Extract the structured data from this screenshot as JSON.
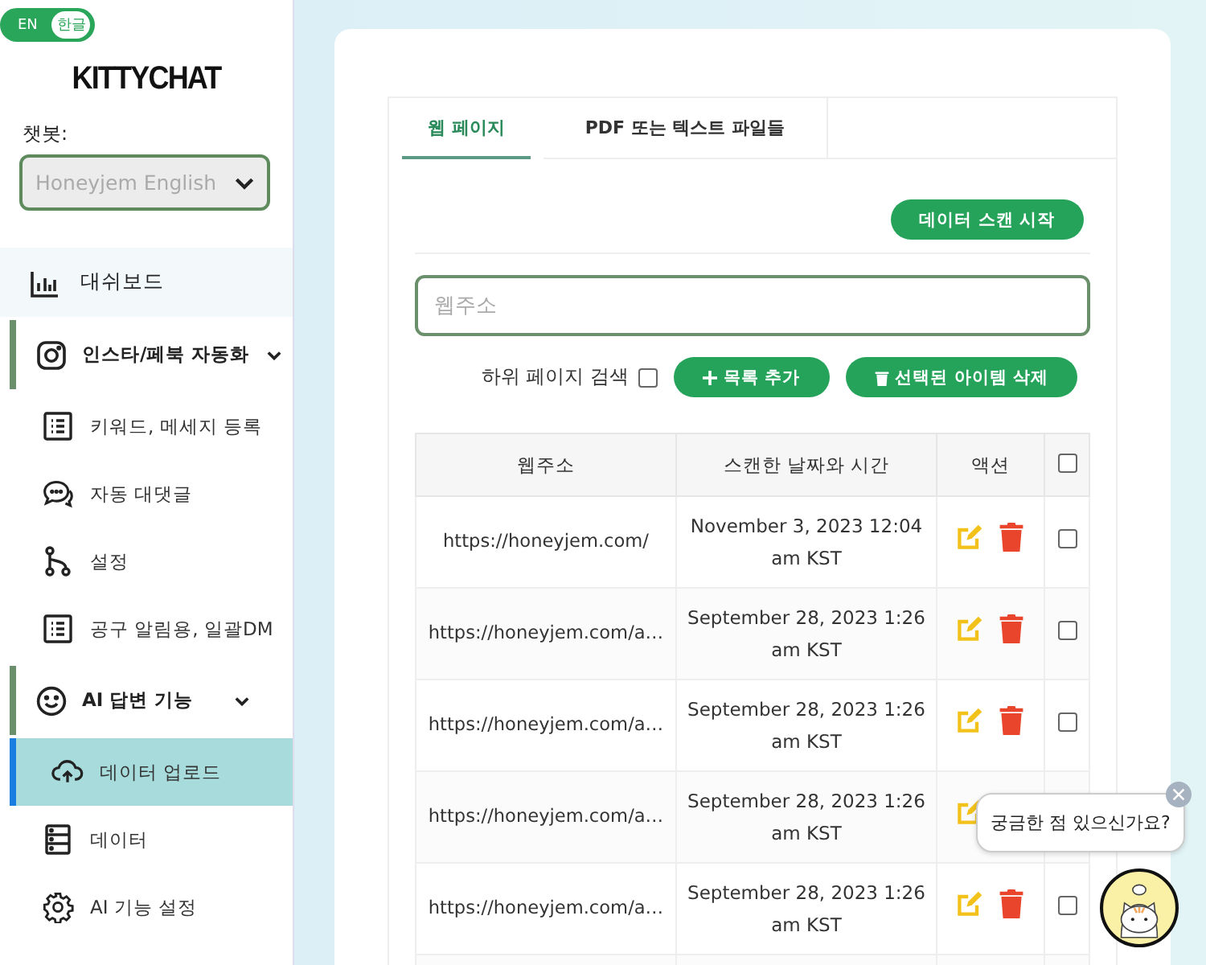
{
  "language_toggle": [
    {
      "label": "EN",
      "selected": false
    },
    {
      "label": "한글",
      "selected": true
    }
  ],
  "logo": "KITTYCHAT",
  "chatbot_select": {
    "label": "챗봇:",
    "value": "Honeyjem English"
  },
  "sidebar": {
    "items": [
      {
        "label": "대쉬보드",
        "kind": "top",
        "selected": false
      },
      {
        "label": "인스타/페북 자동화",
        "kind": "group",
        "expanded": true,
        "children": [
          {
            "label": "키워드, 메세지 등록",
            "selected": false
          },
          {
            "label": "자동 대댓글",
            "selected": false
          },
          {
            "label": "설정",
            "selected": false
          },
          {
            "label": "공구 알림용, 일괄DM",
            "selected": false
          }
        ]
      },
      {
        "label": "AI 답변 기능",
        "kind": "group",
        "expanded": true,
        "children": [
          {
            "label": "데이터 업로드",
            "selected": true
          },
          {
            "label": "데이터",
            "selected": false
          },
          {
            "label": "AI 기능 설정",
            "selected": false
          }
        ]
      }
    ]
  },
  "tabs": [
    {
      "label": "웹 페이지",
      "selected": true
    },
    {
      "label": "PDF 또는 텍스트 파일들",
      "selected": false
    }
  ],
  "scan_button": "데이터 스캔 시작",
  "url_field": {
    "placeholder": "웹주소"
  },
  "subpage_search": {
    "label": "하위 페이지 검색",
    "checked": false
  },
  "add_button": "목록 추가",
  "delete_button": "선택된 아이템 삭제",
  "table": {
    "columns": [
      "웹주소",
      "스캔한 날짜와 시간",
      "액션"
    ],
    "select_all_checked": false,
    "rows": [
      {
        "url": "https://honeyjem.com/",
        "scanned": "November 3, 2023 12:04 am KST",
        "checked": false
      },
      {
        "url": "https://honeyjem.com/a…",
        "scanned": "September 28, 2023 1:26 am KST",
        "checked": false
      },
      {
        "url": "https://honeyjem.com/a…",
        "scanned": "September 28, 2023 1:26 am KST",
        "checked": false
      },
      {
        "url": "https://honeyjem.com/a…",
        "scanned": "September 28, 2023 1:26 am KST"
      },
      {
        "url": "https://honeyjem.com/a…",
        "scanned": "September 28, 2023 1:26 am KST",
        "checked": false
      }
    ]
  },
  "chat_bubble": "궁금한 점 있으신가요?"
}
